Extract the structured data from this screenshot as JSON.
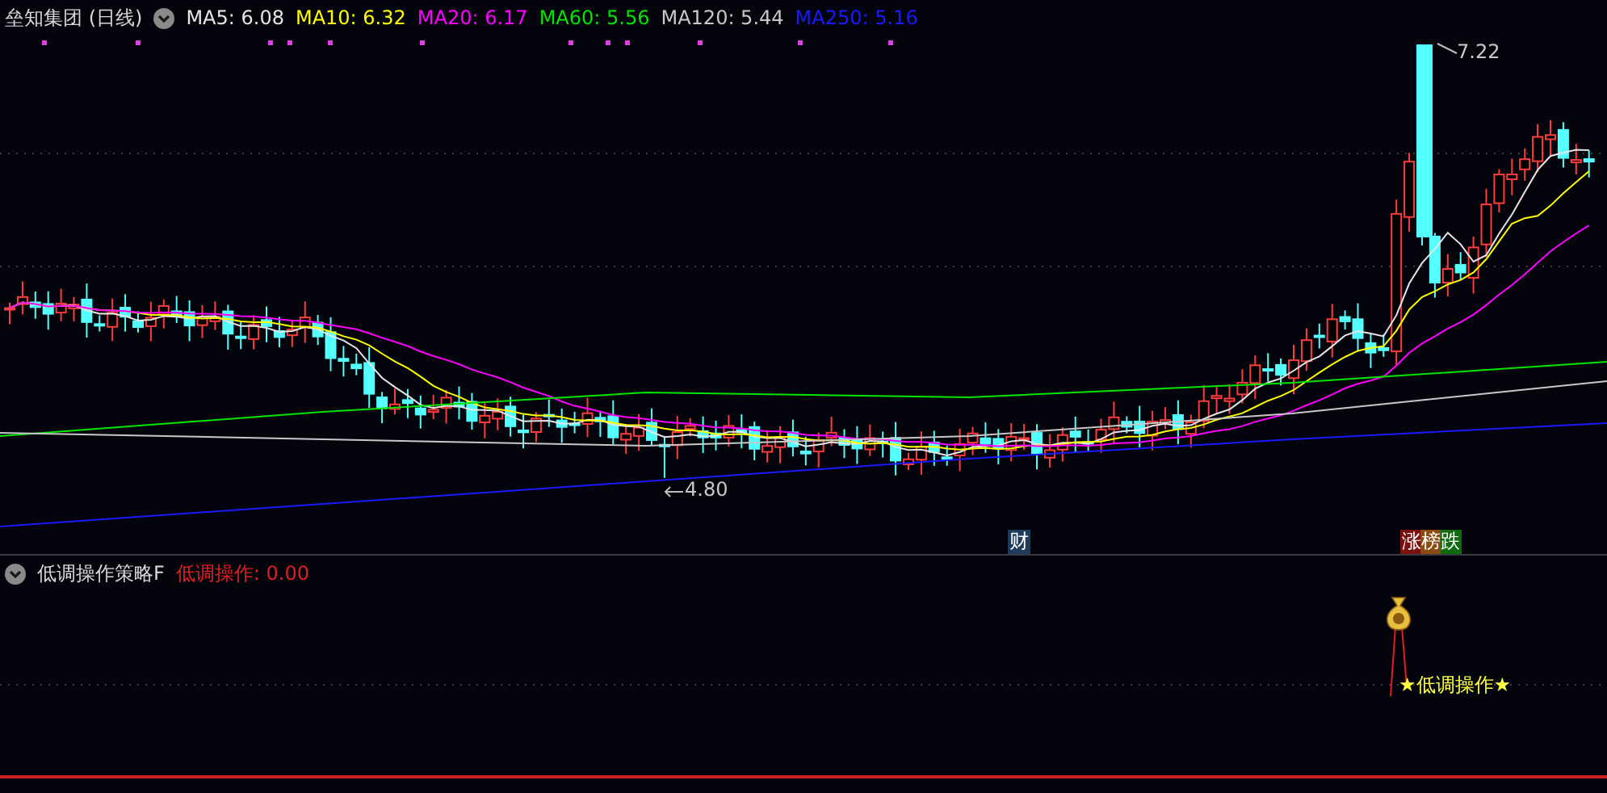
{
  "main_chart": {
    "title": "垒知集团 (日线)",
    "moving_averages": [
      {
        "label": "MA5:",
        "value": "6.08",
        "color": "#e6e6e6"
      },
      {
        "label": "MA10:",
        "value": "6.32",
        "color": "#ffff00"
      },
      {
        "label": "MA20:",
        "value": "6.17",
        "color": "#ff00ff"
      },
      {
        "label": "MA60:",
        "value": "5.56",
        "color": "#00e600"
      },
      {
        "label": "MA120:",
        "value": "5.44",
        "color": "#c8c8c8"
      },
      {
        "label": "MA250:",
        "value": "5.16",
        "color": "#1a1aff"
      }
    ],
    "high_label": "7.22",
    "low_label": "4.80",
    "event_badges": [
      {
        "text": "财"
      },
      {
        "text": "涨榜跌"
      }
    ]
  },
  "indicator_panel": {
    "name": "低调操作策略F",
    "reading": "低调操作: 0.00",
    "signal_label": "★低调操作★"
  }
}
